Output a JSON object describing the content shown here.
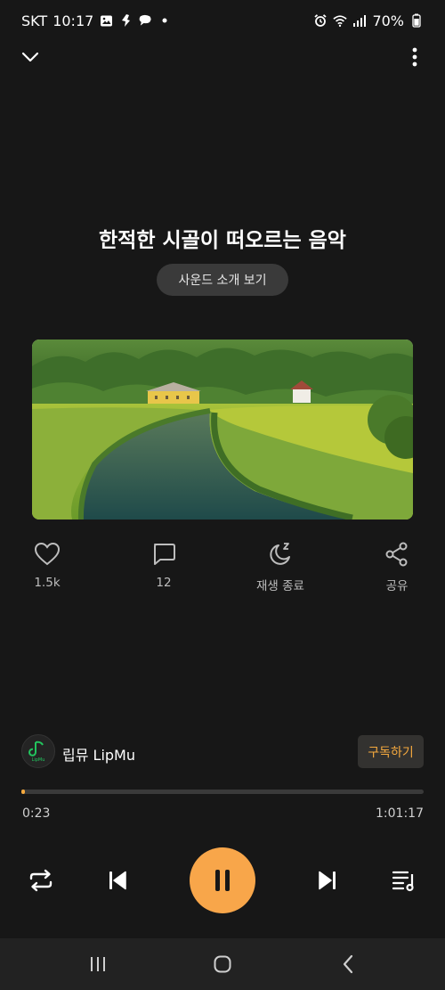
{
  "status_bar": {
    "carrier": "SKT",
    "time": "10:17",
    "battery": "70%",
    "icons": [
      "gallery-icon",
      "app-icon",
      "chat-icon",
      "dot-icon",
      "alarm-icon",
      "wifi-icon",
      "signal-icon",
      "battery-icon"
    ]
  },
  "player": {
    "title": "한적한 시골이 떠오르는 음악",
    "intro_button": "사운드 소개 보기",
    "artwork_icon": "countryside-landscape-image",
    "actions": {
      "like_count": "1.5k",
      "comment_count": "12",
      "sleep_timer_label": "재생 종료",
      "share_label": "공유"
    },
    "channel": {
      "name": "립뮤 LipMu",
      "subscribe_label": "구독하기",
      "avatar_text": "LipMu"
    },
    "progress": {
      "current_time": "0:23",
      "total_time": "1:01:17",
      "fraction": 0.006
    }
  },
  "colors": {
    "accent": "#f8a64a",
    "background": "#171717",
    "navbar": "#222222"
  }
}
